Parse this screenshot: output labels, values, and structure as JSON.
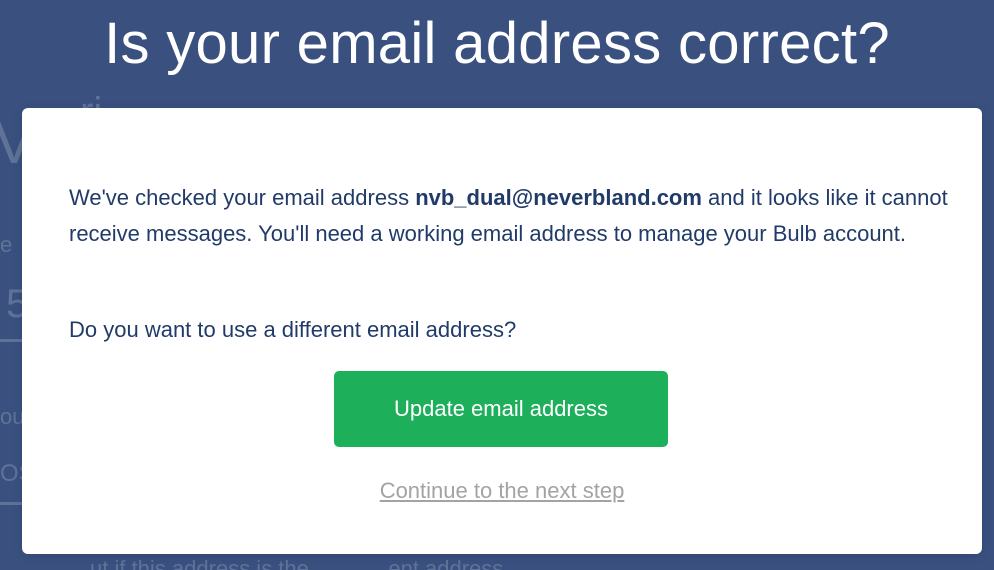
{
  "page": {
    "heading": "Is your email address correct?",
    "background_fragments": [
      "V",
      "e",
      "5",
      "ou",
      "OS",
      "ri",
      "ut if this address is the ...  ...  ... ent address"
    ]
  },
  "modal": {
    "message_before_email": "We've checked your email address ",
    "email": "nvb_dual@neverbland.com",
    "message_after_email": " and it looks like it cannot receive messages. You'll need a working email address to manage your Bulb account.",
    "question": "Do you want to use a different email address?",
    "primary_button_label": "Update email address",
    "secondary_link_label": "Continue to the next step"
  },
  "colors": {
    "backdrop": "#3a5180",
    "text": "#213b69",
    "primary_button": "#1eaf5b",
    "link": "#a3a3a3"
  }
}
